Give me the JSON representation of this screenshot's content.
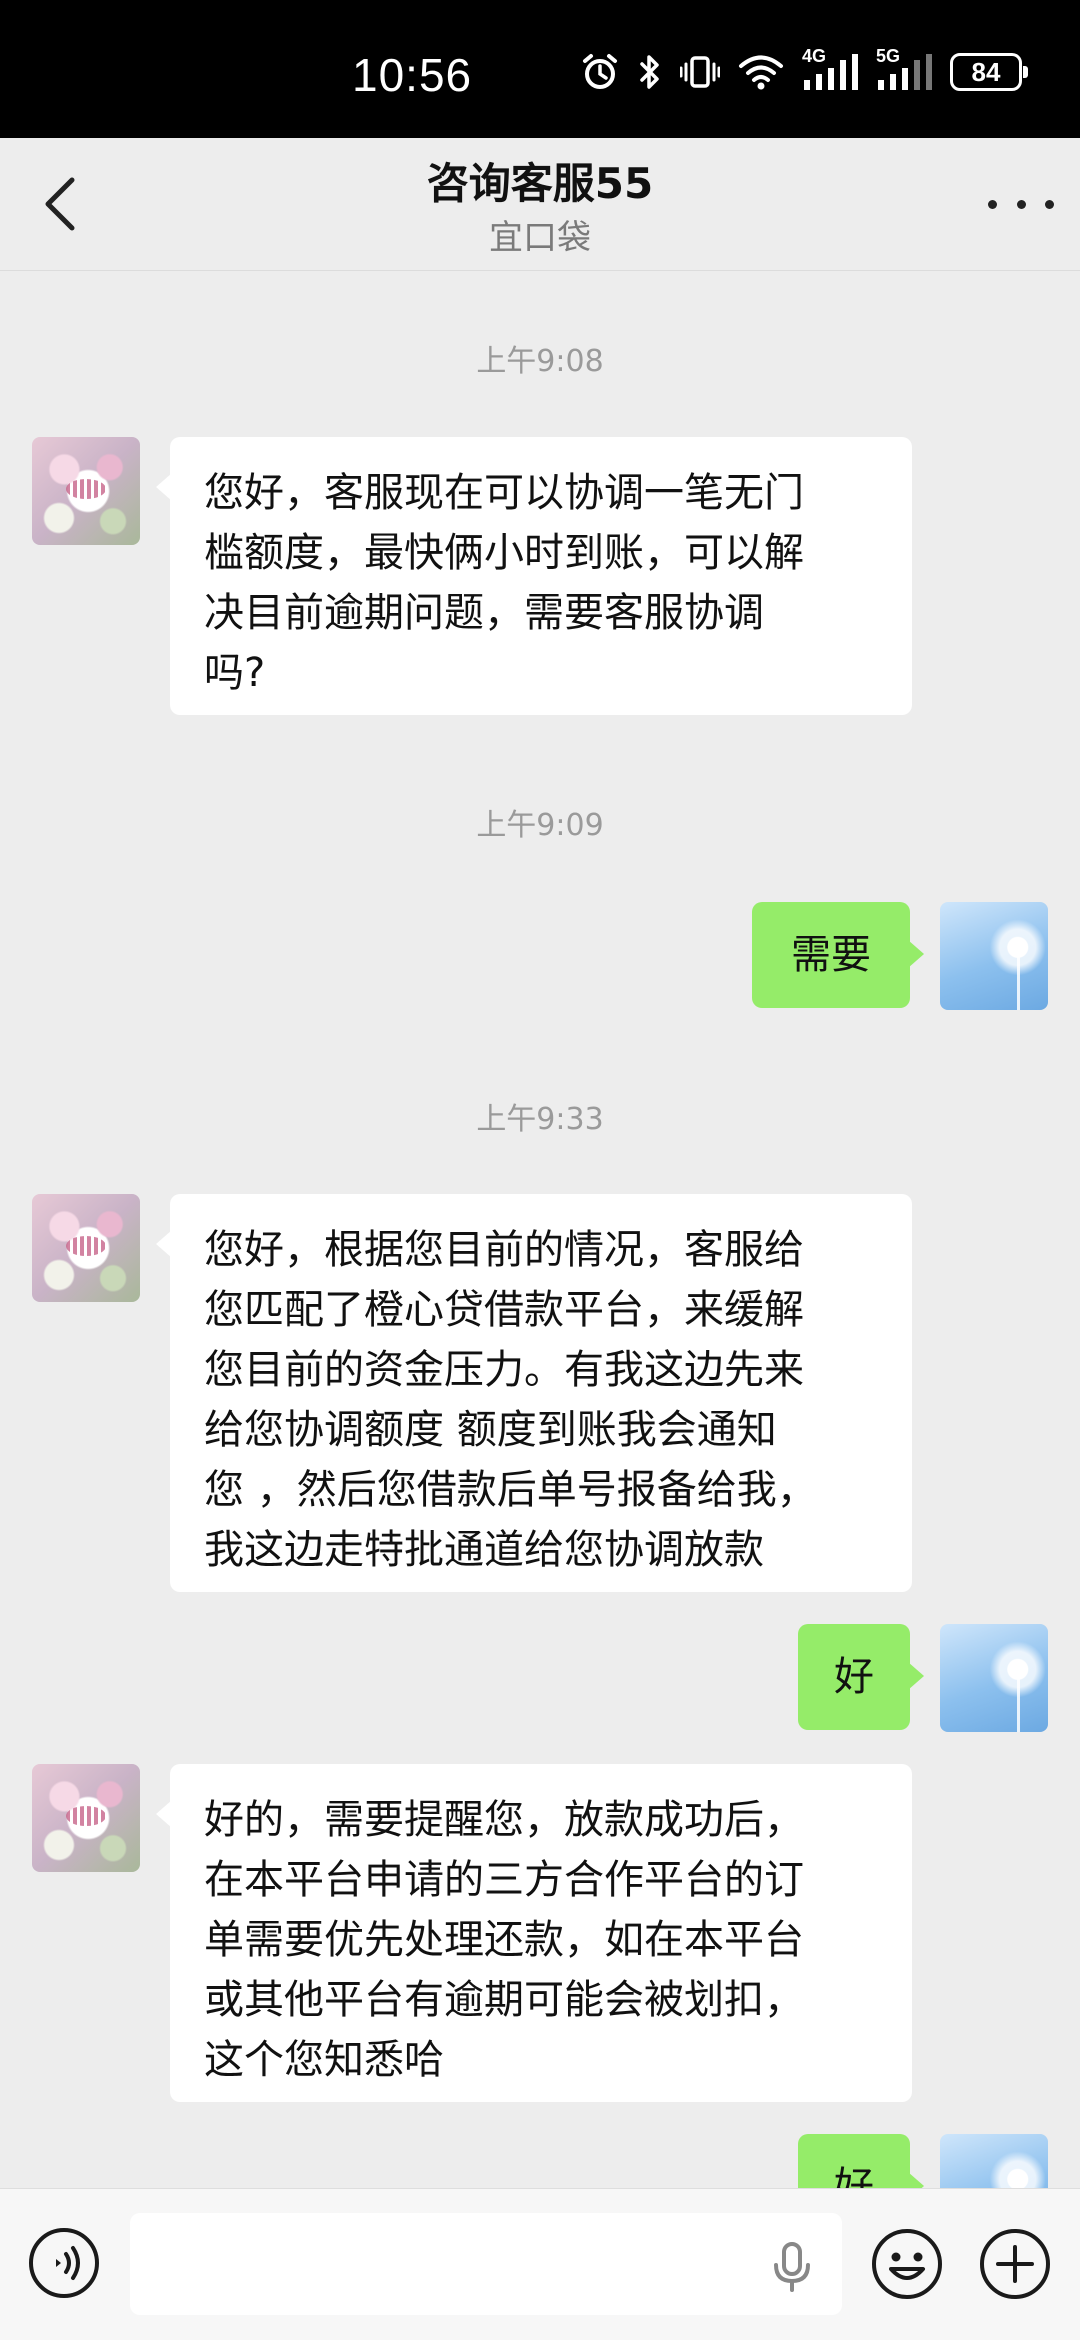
{
  "status_bar": {
    "time": "10:56",
    "network_1": "4G",
    "network_2": "5G",
    "battery": "84"
  },
  "header": {
    "title": "咨询客服55",
    "subtitle": "宜口袋"
  },
  "messages": [
    {
      "type": "timestamp",
      "text": "上午9:08"
    },
    {
      "type": "received",
      "lines": [
        "您好，客服现在可以协调一笔无门",
        "槛额度，最快俩小时到账，可以解",
        "决目前逾期问题，需要客服协调",
        "吗?"
      ]
    },
    {
      "type": "timestamp",
      "text": "上午9:09"
    },
    {
      "type": "sent",
      "text": "需要"
    },
    {
      "type": "timestamp",
      "text": "上午9:33"
    },
    {
      "type": "received",
      "lines": [
        "您好，根据您目前的情况，客服给",
        "您匹配了橙心贷借款平台，来缓解",
        "您目前的资金压力。有我这边先来",
        "给您协调额度 额度到账我会通知",
        "您 ，然后您借款后单号报备给我，",
        "我这边走特批通道给您协调放款"
      ]
    },
    {
      "type": "sent",
      "text": "好"
    },
    {
      "type": "received",
      "lines": [
        "好的，需要提醒您，放款成功后，",
        "在本平台申请的三方合作平台的订",
        "单需要优先处理还款，如在本平台",
        "或其他平台有逾期可能会被划扣，",
        "这个您知悉哈"
      ]
    },
    {
      "type": "sent",
      "text": "好"
    }
  ],
  "input_bar": {
    "message_value": ""
  },
  "icons": {
    "back": "chevron-left-icon",
    "more": "more-dots-icon",
    "voice": "voice-mode-icon",
    "mic": "microphone-icon",
    "emoji": "emoji-icon",
    "plus": "plus-icon"
  },
  "colors": {
    "sent_bubble": "#95ec69",
    "received_bubble": "#ffffff",
    "chat_background": "#ededed",
    "status_bar": "#000000"
  }
}
